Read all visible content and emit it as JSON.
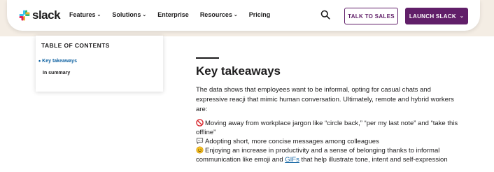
{
  "header": {
    "logo_text": "slack",
    "nav": [
      {
        "label": "Features",
        "has_dropdown": true
      },
      {
        "label": "Solutions",
        "has_dropdown": true
      },
      {
        "label": "Enterprise",
        "has_dropdown": false
      },
      {
        "label": "Resources",
        "has_dropdown": true
      },
      {
        "label": "Pricing",
        "has_dropdown": false
      }
    ],
    "search_icon": "search-icon",
    "talk_to_sales": "TALK TO SALES",
    "launch_slack": "LAUNCH SLACK",
    "brand_color": "#611f69"
  },
  "toc": {
    "title": "TABLE OF CONTENTS",
    "items": [
      {
        "label": "Key takeaways",
        "active": true
      },
      {
        "label": "In summary",
        "active": false
      }
    ],
    "active_color": "#1264a3"
  },
  "article": {
    "heading": "Key takeaways",
    "intro": "The data shows that employees want to be informal, opting for casual chats and expressive reacji that mimic human conversation. Ultimately, remote and hybrid workers are:",
    "bullets": [
      {
        "icon": "no-entry-icon",
        "text": "Moving away from workplace jargon like “circle back,” “per my last note” and “take this offline”"
      },
      {
        "icon": "speech-bubble-icon",
        "text": "Adopting short, more concise messages among colleagues"
      },
      {
        "icon": "smile-icon",
        "text_before": "Enjoying an increase in productivity and a sense of belonging thanks to informal communication like emoji and ",
        "link": "GIFs",
        "text_after": " that help illustrate tone, intent and self-expression"
      }
    ]
  }
}
